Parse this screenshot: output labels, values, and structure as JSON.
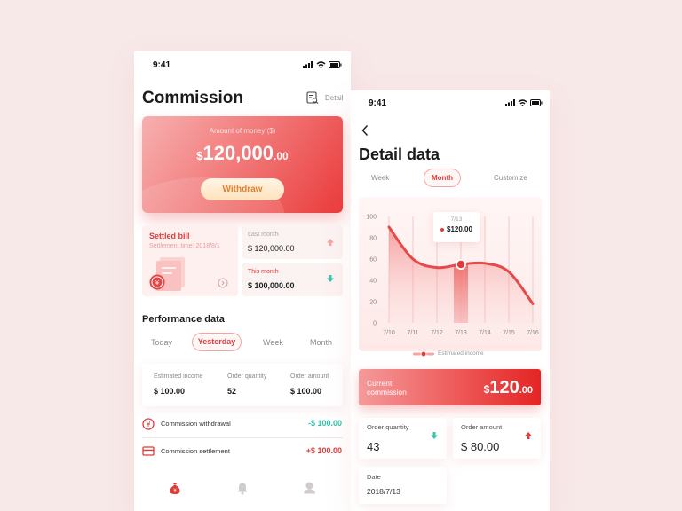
{
  "colors": {
    "accent": "#e03b3b",
    "positive": "#2fbfa8",
    "negative": "#e03b3b",
    "background": "#f7e9e8"
  },
  "left_phone": {
    "status_time": "9:41",
    "title": "Commission",
    "detail_label": "Detail",
    "money_card": {
      "label": "Amount of money ($)",
      "currency": "$",
      "amount_int": "120,000",
      "amount_dec": ".00",
      "withdraw_label": "Withdraw"
    },
    "settled_bill": {
      "title": "Settled bill",
      "subtitle": "Settlement time: 2018/8/1"
    },
    "last_month": {
      "label": "Last month",
      "value": "$ 120,000.00",
      "trend": "up"
    },
    "this_month": {
      "label": "This month",
      "value": "$ 100,000.00",
      "trend": "down"
    },
    "performance": {
      "title": "Performance data",
      "tabs": [
        "Today",
        "Yesterday",
        "Week",
        "Month"
      ],
      "active_tab": "Yesterday",
      "stats": [
        {
          "label": "Estimated income",
          "value": "$ 100.00"
        },
        {
          "label": "Order quantity",
          "value": "52"
        },
        {
          "label": "Order amount",
          "value": "$ 100.00"
        }
      ]
    },
    "transactions": [
      {
        "icon": "yen-circle-icon",
        "label": "Commission withdrawal",
        "amount": "-$ 100.00"
      },
      {
        "icon": "card-icon",
        "label": "Commission settlement",
        "amount": "+$ 100.00"
      }
    ],
    "nav_icons": [
      "money-bag-icon",
      "bell-icon",
      "profile-icon"
    ]
  },
  "right_phone": {
    "status_time": "9:41",
    "title": "Detail data",
    "tabs": [
      "Week",
      "Month",
      "Customize"
    ],
    "active_tab": "Month",
    "tooltip": {
      "date": "7/13",
      "value": "$120.00"
    },
    "legend": "Estimated income",
    "current_commission": {
      "label_line1": "Current",
      "label_line2": "commission",
      "currency": "$",
      "amount_int": "120",
      "amount_dec": ".00"
    },
    "order_quantity": {
      "label": "Order quantity",
      "value": "43",
      "trend": "down"
    },
    "order_amount": {
      "label": "Order amount",
      "value": "$ 80.00",
      "trend": "up"
    },
    "date": {
      "label": "Date",
      "value": "2018/7/13"
    }
  },
  "chart_data": {
    "type": "line",
    "categories": [
      "7/10",
      "7/11",
      "7/12",
      "7/13",
      "7/14",
      "7/15",
      "7/16"
    ],
    "series": [
      {
        "values": [
          90,
          60,
          52,
          55,
          56,
          48,
          18
        ]
      }
    ],
    "y_ticks": [
      0,
      20,
      40,
      60,
      80,
      100
    ],
    "ylim": [
      0,
      100
    ],
    "highlight_category": "7/13",
    "grid": "vertical"
  }
}
